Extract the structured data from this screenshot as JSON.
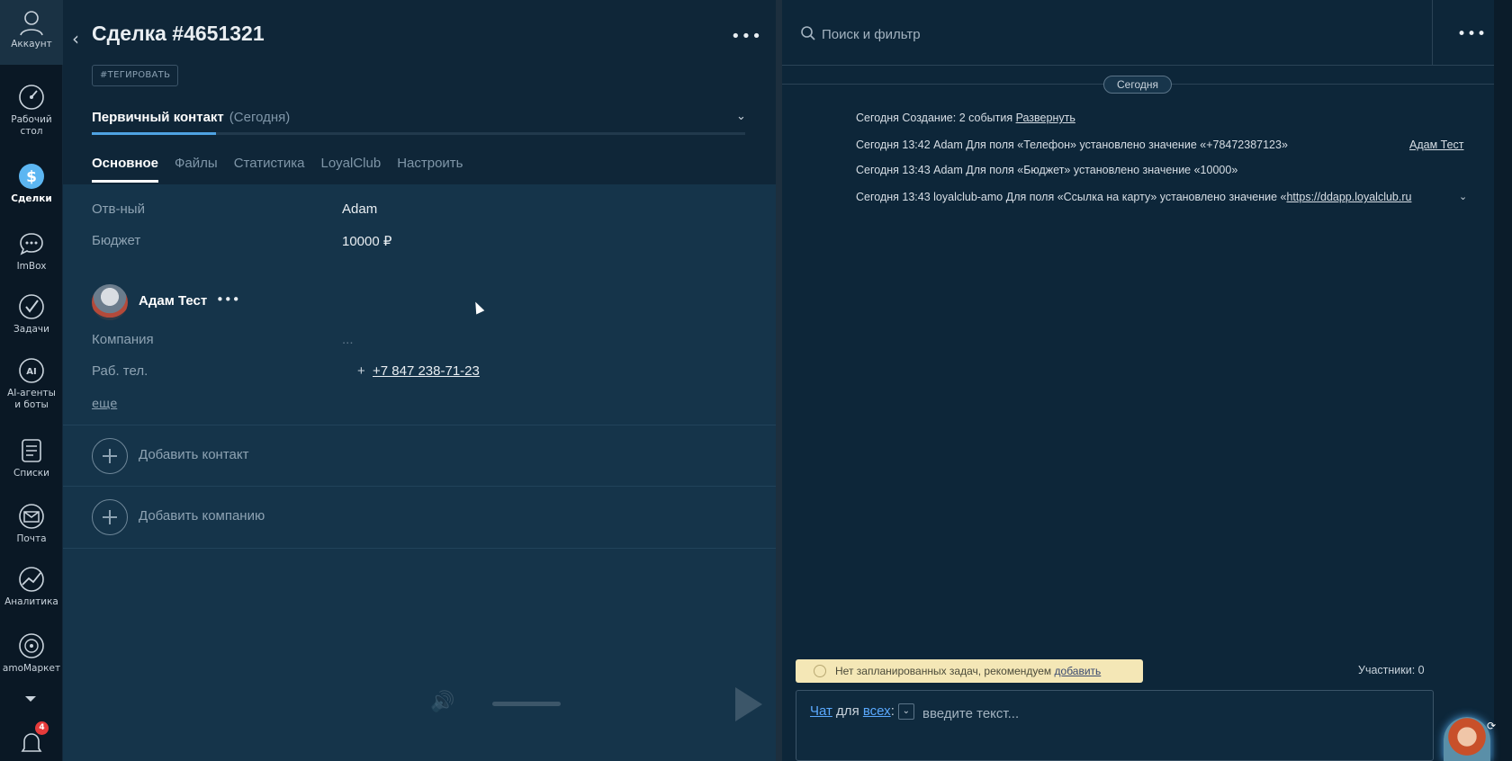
{
  "nav": {
    "account": "Аккаунт",
    "items": [
      {
        "label": "Рабочий\nстол",
        "icon": "dashboard-icon"
      },
      {
        "label": "Сделки",
        "icon": "deals-icon",
        "active": true
      },
      {
        "label": "ImBox",
        "icon": "chat-icon"
      },
      {
        "label": "Задачи",
        "icon": "tasks-icon"
      },
      {
        "label": "AI-агенты\nи боты",
        "icon": "ai-icon"
      },
      {
        "label": "Списки",
        "icon": "lists-icon"
      },
      {
        "label": "Почта",
        "icon": "mail-icon"
      },
      {
        "label": "Аналитика",
        "icon": "analytics-icon"
      },
      {
        "label": "amoМаркет",
        "icon": "market-icon"
      }
    ],
    "notifications_count": "4"
  },
  "deal": {
    "title": "Сделка #4651321",
    "tag_button": "#ТЕГИРОВАТЬ",
    "stage": "Первичный контакт",
    "stage_when": "(Сегодня)",
    "stage_progress": 0.19,
    "tabs": [
      "Основное",
      "Файлы",
      "Статистика",
      "LoyalClub",
      "Настроить"
    ],
    "fields": {
      "responsible_label": "Отв-ный",
      "responsible_value": "Adam",
      "budget_label": "Бюджет",
      "budget_value": "10000 ₽"
    },
    "contact": {
      "name": "Адам Тест",
      "company_label": "Компания",
      "company_value": "...",
      "phone_label": "Раб. тел.",
      "phone_value": "+7 847 238-71-23",
      "more": "еще"
    },
    "add_contact": "Добавить контакт",
    "add_company": "Добавить компанию"
  },
  "feed": {
    "search_placeholder": "Поиск и фильтр",
    "today_label": "Сегодня",
    "events": [
      {
        "text": "Сегодня Создание: 2 события ",
        "link": "Развернуть"
      },
      {
        "text": "Сегодня 13:42 Adam Для поля «Телефон» установлено значение «+78472387123»",
        "link": ""
      },
      {
        "text": "Сегодня 13:43 Adam Для поля «Бюджет» установлено значение «10000»",
        "link": ""
      },
      {
        "text": "Сегодня 13:43 loyalclub-amo Для поля «Ссылка на карту» установлено значение «",
        "link": "https://ddapp.loyalclub.ru"
      }
    ],
    "event_author": "Адам Тест",
    "tasks_notice": "Нет запланированных задач, рекомендуем ",
    "tasks_notice_link": "добавить",
    "participants": "Участники: 0",
    "chat": {
      "link1": "Чат",
      "mid": " для ",
      "link2": "всех",
      "colon": ":",
      "placeholder": "введите текст..."
    }
  }
}
